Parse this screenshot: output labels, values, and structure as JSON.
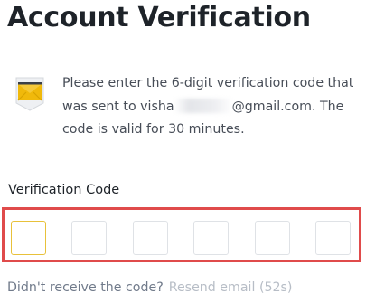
{
  "page": {
    "title": "Account Verification"
  },
  "message": {
    "line_prefix": "Please enter the 6-digit verification code that was sent to visha",
    "line_suffix": "@gmail.com. The code is valid for 30 minutes."
  },
  "form": {
    "label": "Verification Code",
    "digits": [
      "",
      "",
      "",
      "",
      "",
      ""
    ],
    "active_index": 0
  },
  "resend": {
    "question": "Didn't receive the code?",
    "link": "Resend email (52s)"
  },
  "colors": {
    "highlight_border": "#e04b4b",
    "active_input_border": "#e8c13a",
    "envelope_yellow": "#f0b90b"
  },
  "icons": {
    "mail": "envelope-icon"
  }
}
